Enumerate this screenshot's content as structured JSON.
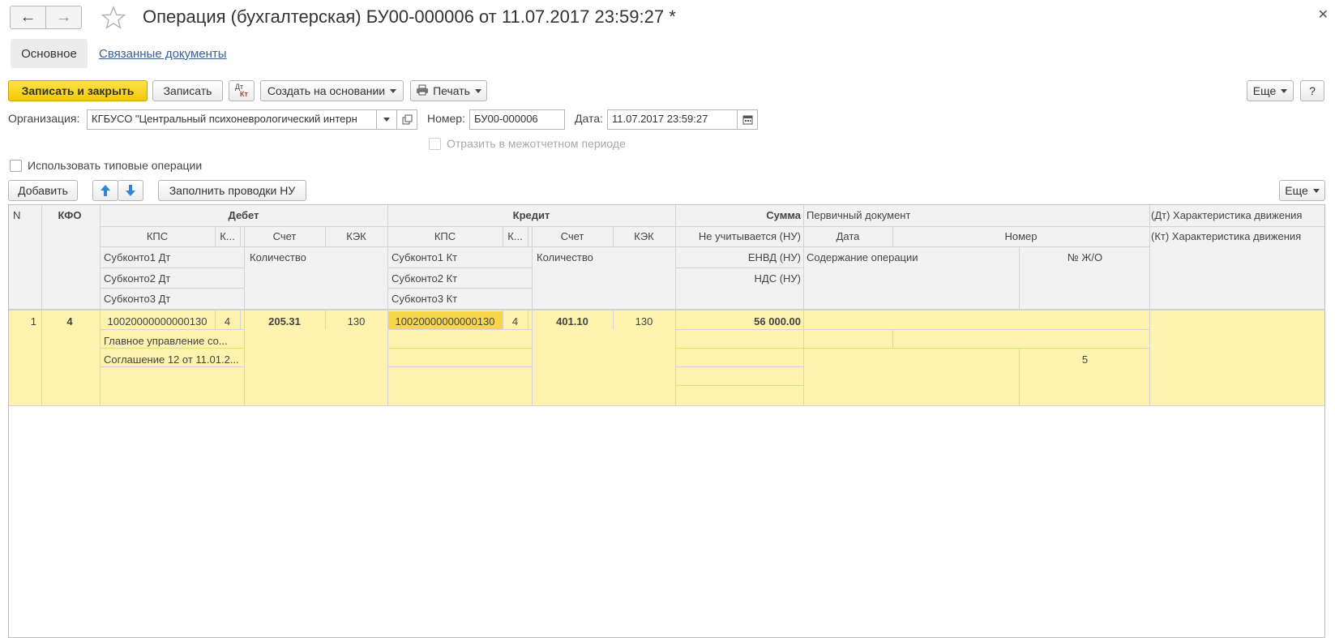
{
  "window": {
    "title": "Операция (бухгалтерская) БУ00-000006 от 11.07.2017 23:59:27 *"
  },
  "tabs": {
    "main": "Основное",
    "related": "Связанные документы"
  },
  "toolbar": {
    "save_close": "Записать и закрыть",
    "save": "Записать",
    "dt": "Дт",
    "kt": "Кт",
    "create_based": "Создать на основании",
    "print": "Печать",
    "more": "Еще",
    "help": "?"
  },
  "form": {
    "org_label": "Организация:",
    "org_value": "КГБУСО \"Центральный психоневрологический интерн",
    "number_label": "Номер:",
    "number_value": "БУ00-000006",
    "date_label": "Дата:",
    "date_value": "11.07.2017 23:59:27",
    "interperiod_label": "Отразить в межотчетном периоде",
    "typical_ops_label": "Использовать типовые операции"
  },
  "table_toolbar": {
    "add": "Добавить",
    "fill_nu": "Заполнить проводки НУ",
    "more": "Еще"
  },
  "grid": {
    "headers": {
      "n": "N",
      "kfo": "КФО",
      "debet": "Дебет",
      "kredit": "Кредит",
      "summa": "Сумма",
      "primary_doc": "Первичный документ",
      "dt_char": "(Дт) Характеристика движения",
      "kt_char": "(Кт) Характеристика движения",
      "kps": "КПС",
      "k": "К...",
      "schet": "Счет",
      "kek": "КЭК",
      "ne_uchit": "Не учитывается (НУ)",
      "data": "Дата",
      "nomer": "Номер",
      "sub1dt": "Субконто1 Дт",
      "sub2dt": "Субконто2 Дт",
      "sub3dt": "Субконто3 Дт",
      "sub1kt": "Субконто1 Кт",
      "sub2kt": "Субконто2 Кт",
      "sub3kt": "Субконто3 Кт",
      "kolichestvo": "Количество",
      "envd": "ЕНВД (НУ)",
      "nds": "НДС (НУ)",
      "soderzhanie": "Содержание операции",
      "zho": "№ Ж/О"
    },
    "row": {
      "n": "1",
      "kfo": "4",
      "dt_kps": "10020000000000130",
      "dt_k": "4",
      "dt_schet": "205.31",
      "dt_kek": "130",
      "kt_kps": "10020000000000130",
      "kt_k": "4",
      "kt_schet": "401.10",
      "kt_kek": "130",
      "summa": "56 000.00",
      "sub1dt": "Главное управление со...",
      "sub2dt": "Соглашение 12 от 11.01.2...",
      "zho": "5"
    }
  },
  "colors": {
    "accent": "#f5c900",
    "row_highlight": "#fdf2ae",
    "selected_cell": "#f7d64a",
    "link": "#3a5f9a"
  }
}
